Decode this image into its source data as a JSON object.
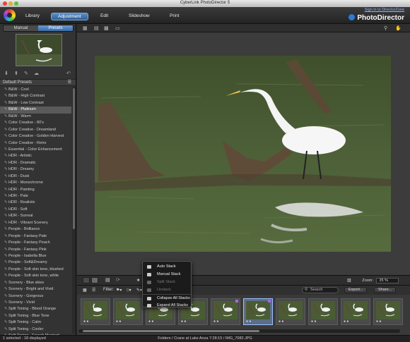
{
  "window": {
    "title": "CyberLink PhotoDirector 5"
  },
  "nav": {
    "tabs": [
      "Library",
      "Adjustment",
      "Edit",
      "Slideshow",
      "Print"
    ],
    "signin": "Sign in to DirectorZone",
    "brand": "PhotoDirector"
  },
  "left": {
    "modes": [
      "Manual",
      "Presets"
    ],
    "presets_header": "Default Presets",
    "presets": [
      "B&W - Cool",
      "B&W - High Contrast",
      "B&W - Low Contrast",
      "B&W - Platinum",
      "B&W - Warm",
      "Color Creative - 80's",
      "Color Creative - Dreamland",
      "Color Creative - Golden Harvest",
      "Color Creative - Retro",
      "Essential - Color Enhancement",
      "HDR - Artistic",
      "HDR - Dramatic",
      "HDR - Dreamy",
      "HDR - Dusk",
      "HDR - Monochrome",
      "HDR - Painting",
      "HDR - Pale",
      "HDR - Realistic",
      "HDR - Soft",
      "HDR - Surreal",
      "HDR - Vibrant Scenery",
      "People - Brilliance",
      "People - Fantasy Pale",
      "People - Fantasy Peach",
      "People - Fantasy Pink",
      "People - Isabella Blue",
      "People - Soft&Dreamy",
      "People - Soft skin tone, blushed",
      "People - Soft skin tone, white",
      "Scenery - Blue skies",
      "Scenery - Bright and Vivid",
      "Scenery - Gorgeous",
      "Scenery - Vivid",
      "Split Toning - Blood Orange",
      "Split Toning - Blue Tone",
      "Split Toning - Calm",
      "Split Toning - Cooler",
      "Split Toning - French Mustard"
    ],
    "selected_preset": "B&W - Platinum"
  },
  "viewbar": {
    "zoom_label": "Zoom:",
    "zoom_value": "25 %"
  },
  "filterbar": {
    "filter_label": "Filter:",
    "search_placeholder": "Search",
    "export_label": "Export...",
    "share_label": "Share..."
  },
  "context_menu": {
    "items": [
      {
        "label": "Auto Stack",
        "enabled": true
      },
      {
        "label": "Manual Stack",
        "enabled": true
      },
      {
        "label": "Split Stack",
        "enabled": false
      },
      {
        "label": "Unstack",
        "enabled": false
      },
      {
        "label": "Collapse All Stacks",
        "enabled": true
      },
      {
        "label": "Expand All Stacks",
        "enabled": true
      }
    ]
  },
  "filmstrip": {
    "thumbnail_count": 10,
    "selected_index": 5,
    "stacked_indices": [
      4,
      5
    ]
  },
  "status": {
    "selection": "1 selected - 18 displayed",
    "path": "Folders / Crane at Lake Anza 7:28:15 / IMG_7082.JPG"
  },
  "colors": {
    "accent": "#3b6aa5",
    "stack_marker": "#a36be0",
    "panel": "#333333",
    "water": "#4a5e36"
  }
}
